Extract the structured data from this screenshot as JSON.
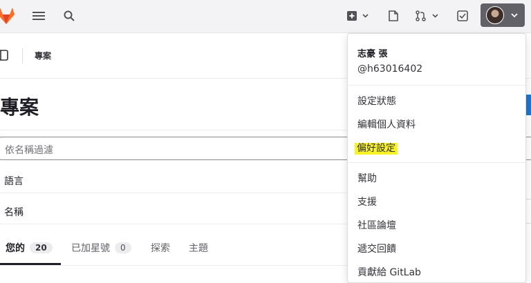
{
  "topbar": {
    "logo_icon": "gitlab-tanuki-icon",
    "menu_icon": "hamburger-icon",
    "search_icon": "search-icon",
    "create_icon": "plus-square-icon",
    "issues_icon": "issues-icon",
    "merge_requests_icon": "merge-request-icon",
    "todos_icon": "todo-check-icon",
    "colors": {
      "bar_bg": "#f3f3f6",
      "avatar_btn_bg": "#626168",
      "logo_orange": "#fc6d26"
    }
  },
  "breadcrumb": {
    "label": "專案"
  },
  "page": {
    "title": "專案",
    "filter_placeholder": "依名稱過濾",
    "language_label": "語言",
    "sort_label": "名稱"
  },
  "tabs": [
    {
      "label": "您的",
      "count": "20"
    },
    {
      "label": "已加星號",
      "count": "0"
    },
    {
      "label": "探索"
    },
    {
      "label": "主題"
    }
  ],
  "dropdown": {
    "user_name": "志豪 張",
    "user_handle": "@h63016402",
    "items": [
      {
        "label": "設定狀態"
      },
      {
        "label": "編輯個人資料"
      },
      {
        "label": "偏好設定",
        "highlight_color": "#f8f326"
      },
      {
        "label": "幫助"
      },
      {
        "label": "支援"
      },
      {
        "label": "社區論壇"
      },
      {
        "label": "遞交回饋"
      },
      {
        "label": "貢獻給 GitLab"
      }
    ]
  }
}
